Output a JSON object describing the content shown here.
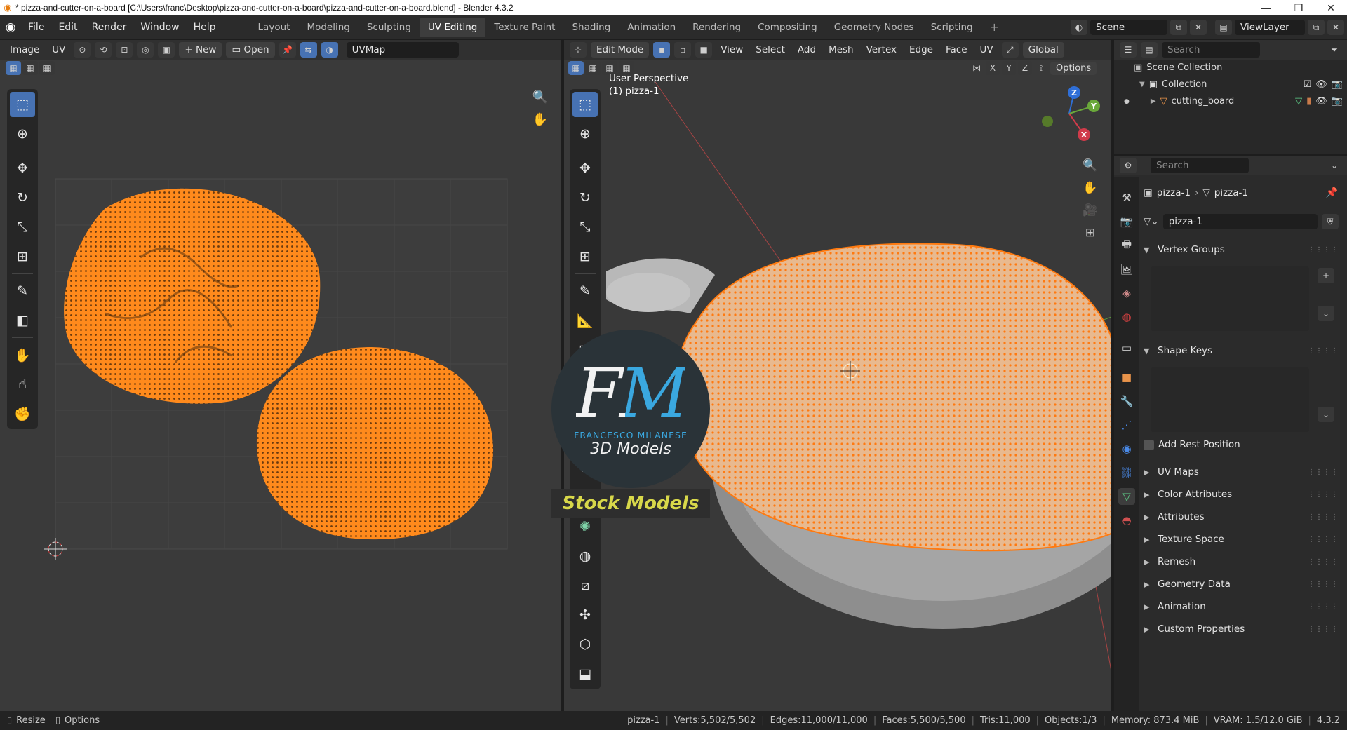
{
  "window": {
    "title": "* pizza-and-cutter-on-a-board [C:\\Users\\franc\\Desktop\\pizza-and-cutter-on-a-board\\pizza-and-cutter-on-a-board.blend] - Blender 4.3.2",
    "controls": [
      "—",
      "❐",
      "✕"
    ]
  },
  "menu": [
    "File",
    "Edit",
    "Render",
    "Window",
    "Help"
  ],
  "workspaces": [
    "Layout",
    "Modeling",
    "Sculpting",
    "UV Editing",
    "Texture Paint",
    "Shading",
    "Animation",
    "Rendering",
    "Compositing",
    "Geometry Nodes",
    "Scripting"
  ],
  "active_workspace": "UV Editing",
  "scene": "Scene",
  "view_layer": "ViewLayer",
  "uv_editor": {
    "header": {
      "menus": [
        "Image",
        "UV"
      ],
      "new_label": "New",
      "open_label": "Open",
      "uvmap": "UVMap"
    },
    "tools": [
      "select-box",
      "cursor",
      "move",
      "rotate",
      "scale",
      "transform",
      "annotate",
      "rip-region",
      "grab",
      "relax",
      "pinch"
    ],
    "colors": {
      "uv_vertex": "#ff8a1c",
      "background": "#3a3a3a",
      "grid": "#444444"
    }
  },
  "viewport": {
    "header": {
      "mode": "Edit Mode",
      "menus": [
        "View",
        "Select",
        "Add",
        "Mesh",
        "Vertex",
        "Edge",
        "Face",
        "UV"
      ],
      "orientation": "Global",
      "options": "Options"
    },
    "overlay": {
      "perspective": "User Perspective",
      "object": "(1) pizza-1"
    },
    "gizmo_axes": {
      "z": "Z",
      "y": "Y",
      "x": "X"
    },
    "watermark": {
      "letters": "FM",
      "author": "FRANCESCO MILANESE",
      "subtitle": "3D Models",
      "banner": "Stock Models"
    }
  },
  "outliner": {
    "search_placeholder": "Search",
    "items": [
      {
        "label": "Scene Collection"
      },
      {
        "label": "Collection"
      },
      {
        "label": "cutting_board"
      }
    ]
  },
  "properties": {
    "search_placeholder": "Search",
    "breadcrumb": [
      "pizza-1",
      "pizza-1"
    ],
    "mesh_name": "pizza-1",
    "sections": {
      "vertex_groups": "Vertex Groups",
      "shape_keys": "Shape Keys",
      "add_rest_position": "Add Rest Position",
      "uv_maps": "UV Maps",
      "color_attributes": "Color Attributes",
      "attributes": "Attributes",
      "texture_space": "Texture Space",
      "remesh": "Remesh",
      "geometry_data": "Geometry Data",
      "animation": "Animation",
      "custom_properties": "Custom Properties"
    }
  },
  "statusbar": {
    "left": [
      "Resize",
      "Options"
    ],
    "object": "pizza-1",
    "verts": "Verts:5,502/5,502",
    "edges": "Edges:11,000/11,000",
    "faces": "Faces:5,500/5,500",
    "tris": "Tris:11,000",
    "objects": "Objects:1/3",
    "memory": "Memory: 873.4 MiB",
    "vram": "VRAM: 1.5/12.0 GiB",
    "version": "4.3.2"
  }
}
